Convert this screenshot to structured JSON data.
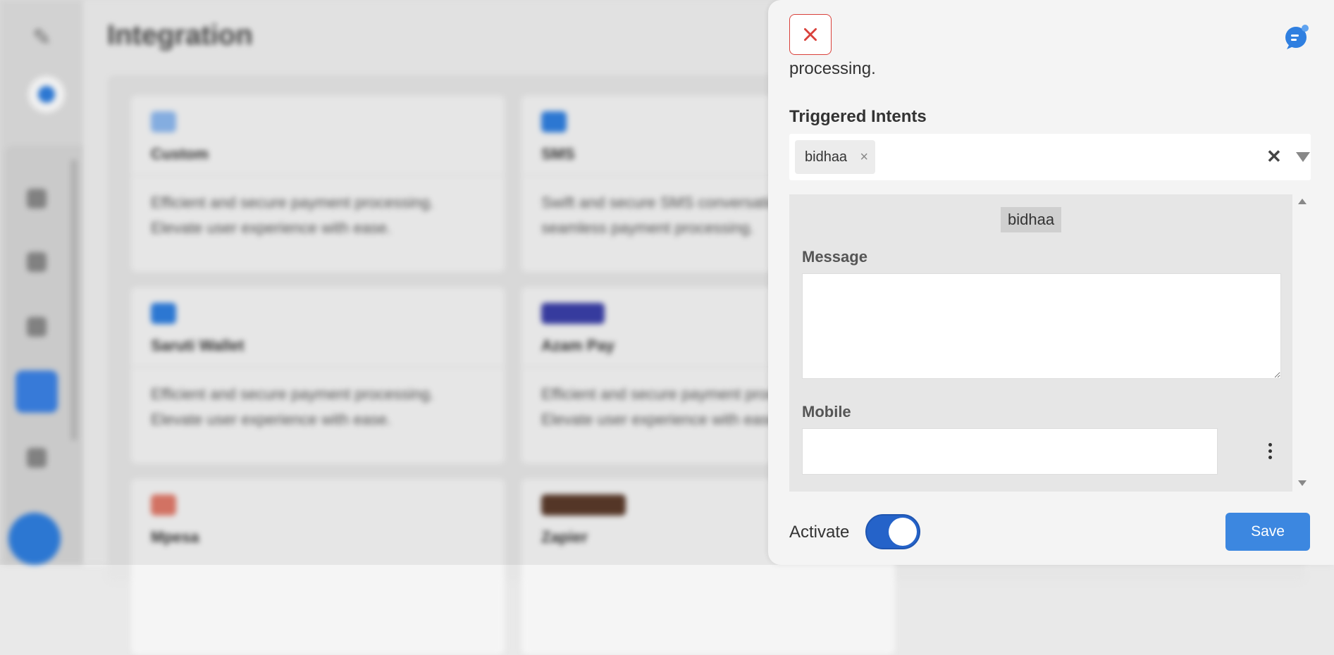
{
  "background": {
    "page_title": "Integration",
    "cards": [
      {
        "name": "Custom",
        "description": "Efficient and secure payment processing. Elevate user experience with ease."
      },
      {
        "name": "SMS",
        "description": "Swift and secure SMS conversations, seamless payment processing."
      },
      {
        "name": "Saruti Wallet",
        "description": "Efficient and secure payment processing. Elevate user experience with ease."
      },
      {
        "name": "Azam Pay",
        "description": "Efficient and secure payment processing. Elevate user experience with ease."
      },
      {
        "name": "Mpesa",
        "description": ""
      },
      {
        "name": "Zapier",
        "description": ""
      }
    ]
  },
  "drawer": {
    "close_icon": "close-icon",
    "chat_icon": "chat-bubble-icon",
    "cut_off_text": "processing.",
    "triggered_intents_label": "Triggered Intents",
    "selected_intents": [
      "bidhaa"
    ],
    "chip_remove_symbol": "×",
    "clear_symbol": "✕",
    "intent_block": {
      "tag": "bidhaa",
      "message_label": "Message",
      "message_value": "",
      "mobile_label": "Mobile",
      "mobile_value": ""
    },
    "footer": {
      "activate_label": "Activate",
      "activate_on": true,
      "save_label": "Save"
    },
    "colors": {
      "close_red": "#d9403a",
      "toggle_blue": "#2563c9",
      "save_blue": "#3c87e0"
    }
  }
}
